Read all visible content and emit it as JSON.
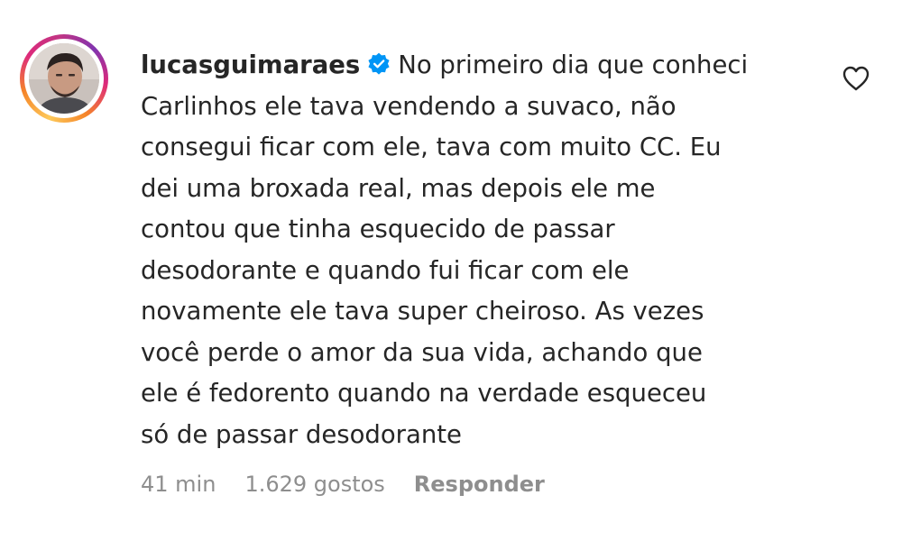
{
  "comment": {
    "username": "lucasguimaraes",
    "verified_icon": "verified-badge-icon",
    "text_lines": [
      "No primeiro dia que conheci",
      "Carlinhos ele tava vendendo a suvaco, não",
      "consegui ficar com ele, tava com muito CC. Eu",
      "dei uma broxada real, mas depois ele me",
      "contou que tinha esquecido de passar",
      "desodorante e quando fui ficar com ele",
      "novamente ele tava super cheiroso. As vezes",
      "você perde o amor da sua vida, achando que",
      "ele é fedorento quando na verdade esqueceu",
      "só de passar desodorante"
    ],
    "time": "41 min",
    "likes": "1.629 gostos",
    "reply_label": "Responder",
    "like_icon": "heart-icon"
  },
  "colors": {
    "text": "#262626",
    "meta": "#8e8e8e",
    "verified": "#0095f6"
  }
}
